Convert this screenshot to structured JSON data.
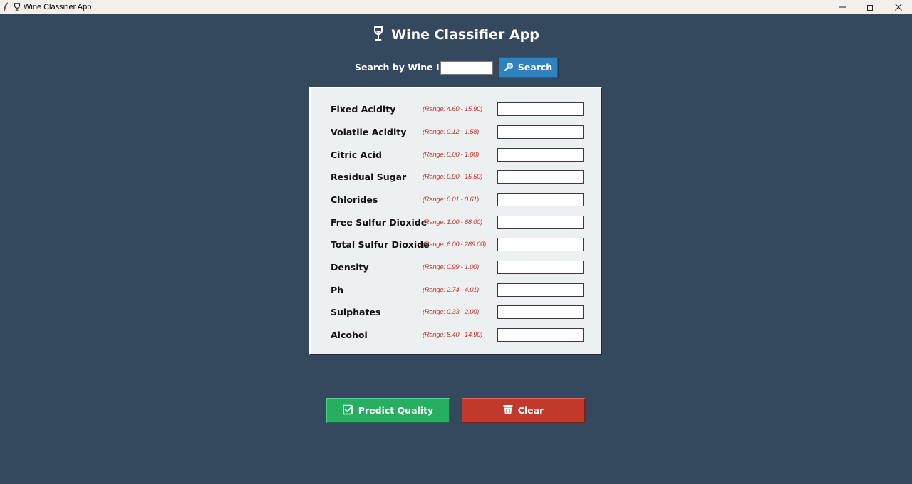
{
  "window": {
    "title": "Wine Classifier App",
    "controls": [
      "minimize",
      "restore",
      "close"
    ]
  },
  "header": {
    "icon": "wine-glass-icon",
    "title": "Wine Classifier App"
  },
  "search": {
    "label": "Search by Wine ID:",
    "value": "",
    "button_icon": "magnifier-icon",
    "button_label": "Search"
  },
  "features": [
    {
      "label": "Fixed Acidity",
      "range": "(Range: 4.60 - 15.90)",
      "value": ""
    },
    {
      "label": "Volatile Acidity",
      "range": "(Range: 0.12 - 1.58)",
      "value": ""
    },
    {
      "label": "Citric Acid",
      "range": "(Range: 0.00 - 1.00)",
      "value": ""
    },
    {
      "label": "Residual Sugar",
      "range": "(Range: 0.90 - 15.50)",
      "value": ""
    },
    {
      "label": "Chlorides",
      "range": "(Range: 0.01 - 0.61)",
      "value": ""
    },
    {
      "label": "Free Sulfur Dioxide",
      "range": "(Range: 1.00 - 68.00)",
      "value": ""
    },
    {
      "label": "Total Sulfur Dioxide",
      "range": "(Range: 6.00 - 289.00)",
      "value": ""
    },
    {
      "label": "Density",
      "range": "(Range: 0.99 - 1.00)",
      "value": ""
    },
    {
      "label": "Ph",
      "range": "(Range: 2.74 - 4.01)",
      "value": ""
    },
    {
      "label": "Sulphates",
      "range": "(Range: 0.33 - 2.00)",
      "value": ""
    },
    {
      "label": "Alcohol",
      "range": "(Range: 8.40 - 14.90)",
      "value": ""
    }
  ],
  "actions": {
    "predict_label": "Predict Quality",
    "predict_icon": "checkbox-icon",
    "clear_label": "Clear",
    "clear_icon": "trash-icon"
  },
  "colors": {
    "background": "#34495e",
    "panel": "#ecf0f1",
    "search_button": "#2f81c0",
    "predict_button": "#27ae60",
    "clear_button": "#c0392b",
    "range_text": "#c0392b"
  }
}
